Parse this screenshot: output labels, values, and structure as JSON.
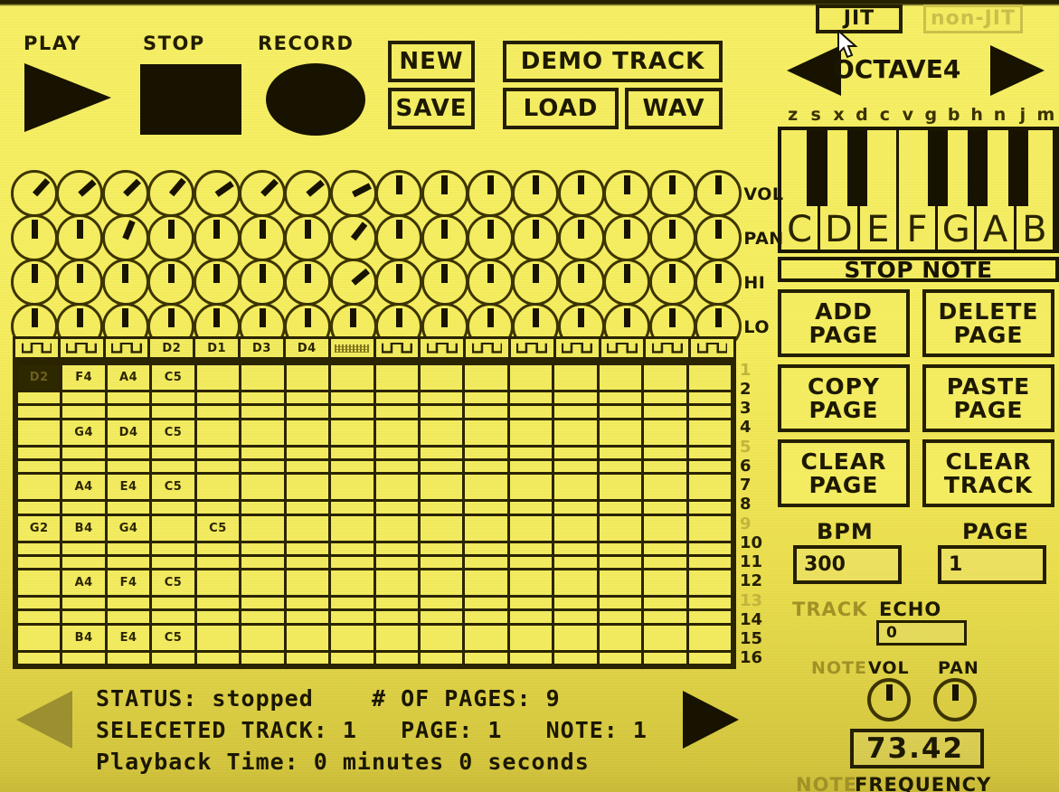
{
  "transport": {
    "play_label": "PLAY",
    "stop_label": "STOP",
    "record_label": "RECORD"
  },
  "file_buttons": {
    "new": "NEW",
    "save": "SAVE",
    "demo_track": "DEMO TRACK",
    "load": "LOAD",
    "wav": "WAV"
  },
  "jit": {
    "active_label": "JIT",
    "inactive_label": "non-JIT"
  },
  "octave": {
    "label": "OCTAVE4",
    "prev_icon": "left-triangle-icon",
    "next_icon": "right-triangle-icon"
  },
  "keyboard": {
    "key_letters": [
      "z",
      "s",
      "x",
      "d",
      "c",
      "v",
      "g",
      "b",
      "h",
      "n",
      "j",
      "m"
    ],
    "white_keys": [
      "C",
      "D",
      "E",
      "F",
      "G",
      "A",
      "B"
    ],
    "stop_note_label": "STOP NOTE"
  },
  "mixer": {
    "rows": [
      {
        "label": "VOL",
        "angles": [
          42,
          48,
          45,
          40,
          55,
          45,
          50,
          63,
          0,
          0,
          0,
          0,
          0,
          0,
          0,
          0
        ]
      },
      {
        "label": "PAN",
        "angles": [
          0,
          0,
          22,
          0,
          0,
          0,
          0,
          38,
          0,
          0,
          0,
          0,
          0,
          0,
          0,
          0
        ]
      },
      {
        "label": "HI",
        "angles": [
          0,
          0,
          0,
          0,
          0,
          0,
          0,
          50,
          0,
          0,
          0,
          0,
          0,
          0,
          0,
          0
        ]
      },
      {
        "label": "LO",
        "angles": [
          0,
          0,
          0,
          0,
          0,
          0,
          0,
          0,
          0,
          0,
          0,
          0,
          0,
          0,
          0,
          0
        ]
      }
    ]
  },
  "sequencer": {
    "track_headers": [
      {
        "type": "wave",
        "label": ""
      },
      {
        "type": "wave",
        "label": ""
      },
      {
        "type": "wave",
        "label": ""
      },
      {
        "type": "text",
        "label": "D2"
      },
      {
        "type": "text",
        "label": "D1"
      },
      {
        "type": "text",
        "label": "D3"
      },
      {
        "type": "text",
        "label": "D4"
      },
      {
        "type": "noise",
        "label": ""
      },
      {
        "type": "wave",
        "label": ""
      },
      {
        "type": "wave",
        "label": ""
      },
      {
        "type": "wave",
        "label": ""
      },
      {
        "type": "wave",
        "label": ""
      },
      {
        "type": "wave",
        "label": ""
      },
      {
        "type": "wave",
        "label": ""
      },
      {
        "type": "wave",
        "label": ""
      },
      {
        "type": "wave",
        "label": ""
      }
    ],
    "row_numbers": [
      "1",
      "2",
      "3",
      "4",
      "5",
      "6",
      "7",
      "8",
      "9",
      "10",
      "11",
      "12",
      "13",
      "14",
      "15",
      "16"
    ],
    "accent_rows": [
      1,
      5,
      9,
      13
    ],
    "selected_cell": {
      "row": 1,
      "col": 1
    },
    "rows": [
      [
        "D2",
        "F4",
        "A4",
        "C5",
        "",
        "",
        "",
        "",
        "",
        "",
        "",
        "",
        "",
        "",
        "",
        ""
      ],
      [
        "",
        "",
        "",
        "",
        "",
        "",
        "",
        "",
        "",
        "",
        "",
        "",
        "",
        "",
        "",
        ""
      ],
      [
        "",
        "",
        "",
        "",
        "",
        "",
        "",
        "",
        "",
        "",
        "",
        "",
        "",
        "",
        "",
        ""
      ],
      [
        "",
        "G4",
        "D4",
        "C5",
        "",
        "",
        "",
        "",
        "",
        "",
        "",
        "",
        "",
        "",
        "",
        ""
      ],
      [
        "",
        "",
        "",
        "",
        "",
        "",
        "",
        "",
        "",
        "",
        "",
        "",
        "",
        "",
        "",
        ""
      ],
      [
        "",
        "",
        "",
        "",
        "",
        "",
        "",
        "",
        "",
        "",
        "",
        "",
        "",
        "",
        "",
        ""
      ],
      [
        "",
        "A4",
        "E4",
        "C5",
        "",
        "",
        "",
        "",
        "",
        "",
        "",
        "",
        "",
        "",
        "",
        ""
      ],
      [
        "",
        "",
        "",
        "",
        "",
        "",
        "",
        "",
        "",
        "",
        "",
        "",
        "",
        "",
        "",
        ""
      ],
      [
        "G2",
        "B4",
        "G4",
        "",
        "C5",
        "",
        "",
        "",
        "",
        "",
        "",
        "",
        "",
        "",
        "",
        ""
      ],
      [
        "",
        "",
        "",
        "",
        "",
        "",
        "",
        "",
        "",
        "",
        "",
        "",
        "",
        "",
        "",
        ""
      ],
      [
        "",
        "",
        "",
        "",
        "",
        "",
        "",
        "",
        "",
        "",
        "",
        "",
        "",
        "",
        "",
        ""
      ],
      [
        "",
        "A4",
        "F4",
        "C5",
        "",
        "",
        "",
        "",
        "",
        "",
        "",
        "",
        "",
        "",
        "",
        ""
      ],
      [
        "",
        "",
        "",
        "",
        "",
        "",
        "",
        "",
        "",
        "",
        "",
        "",
        "",
        "",
        "",
        ""
      ],
      [
        "",
        "",
        "",
        "",
        "",
        "",
        "",
        "",
        "",
        "",
        "",
        "",
        "",
        "",
        "",
        ""
      ],
      [
        "",
        "B4",
        "E4",
        "C5",
        "",
        "",
        "",
        "",
        "",
        "",
        "",
        "",
        "",
        "",
        "",
        ""
      ],
      [
        "",
        "",
        "",
        "",
        "",
        "",
        "",
        "",
        "",
        "",
        "",
        "",
        "",
        "",
        "",
        ""
      ]
    ]
  },
  "page_buttons": {
    "add_page": "ADD\nPAGE",
    "delete_page": "DELETE\nPAGE",
    "copy_page": "COPY\nPAGE",
    "paste_page": "PASTE\nPAGE",
    "clear_page": "CLEAR\nPAGE",
    "clear_track": "CLEAR\nTRACK"
  },
  "settings": {
    "bpm_label": "BPM",
    "bpm_value": "300",
    "page_label": "PAGE",
    "page_value": "1",
    "track_echo_label_1": "TRACK",
    "track_echo_label_2": "ECHO",
    "track_echo_value": "0"
  },
  "note_controls": {
    "note_label": "NOTE",
    "vol_label": "VOL",
    "pan_label": "PAN",
    "vol_angle": 0,
    "pan_angle": 0,
    "frequency_value": "73.42",
    "freq_label_1": "NOTE",
    "freq_label_2": "FREQUENCY"
  },
  "status": {
    "line1": "STATUS: stopped    # OF PAGES: 9",
    "line2": "SELECETED TRACK: 1   PAGE: 1   NOTE: 1",
    "line3": "Playback Time: 0 minutes 0 seconds",
    "prev_icon": "left-triangle-icon",
    "next_icon": "right-triangle-icon"
  },
  "colors": {
    "background": "#f7ef60",
    "ink": "#1d1900",
    "dim_ink": "#a39327",
    "accent_row": "#c6b63c"
  }
}
